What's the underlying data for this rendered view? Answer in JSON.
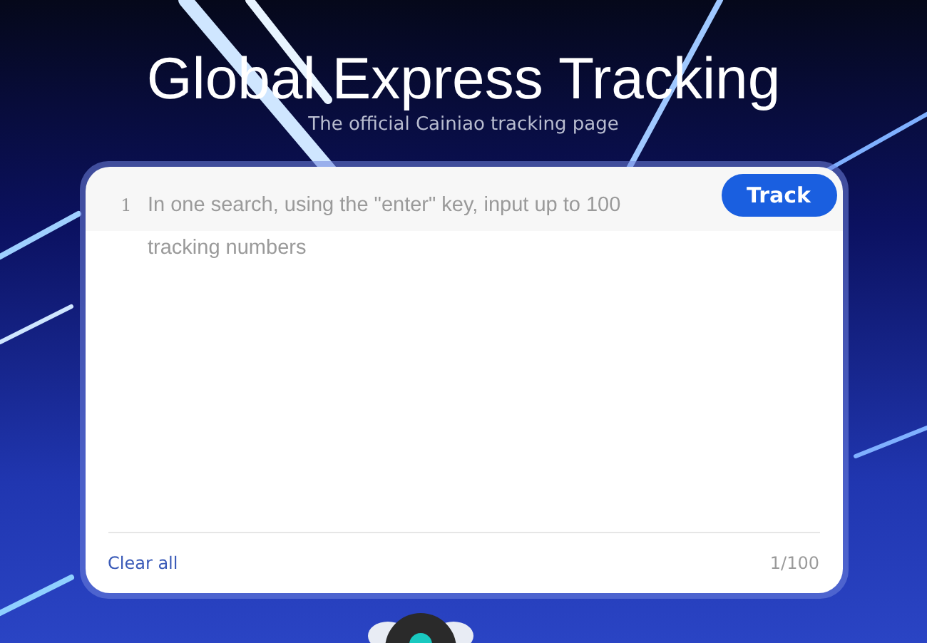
{
  "header": {
    "title": "Global Express Tracking",
    "subtitle": "The official Cainiao tracking page"
  },
  "editor": {
    "line_number": "1",
    "placeholder": "In one search, using the \"enter\" key, input up to 100 tracking numbers"
  },
  "track_button": {
    "label": "Track"
  },
  "footer": {
    "clear_link": "Clear all",
    "counter": "1/100"
  }
}
